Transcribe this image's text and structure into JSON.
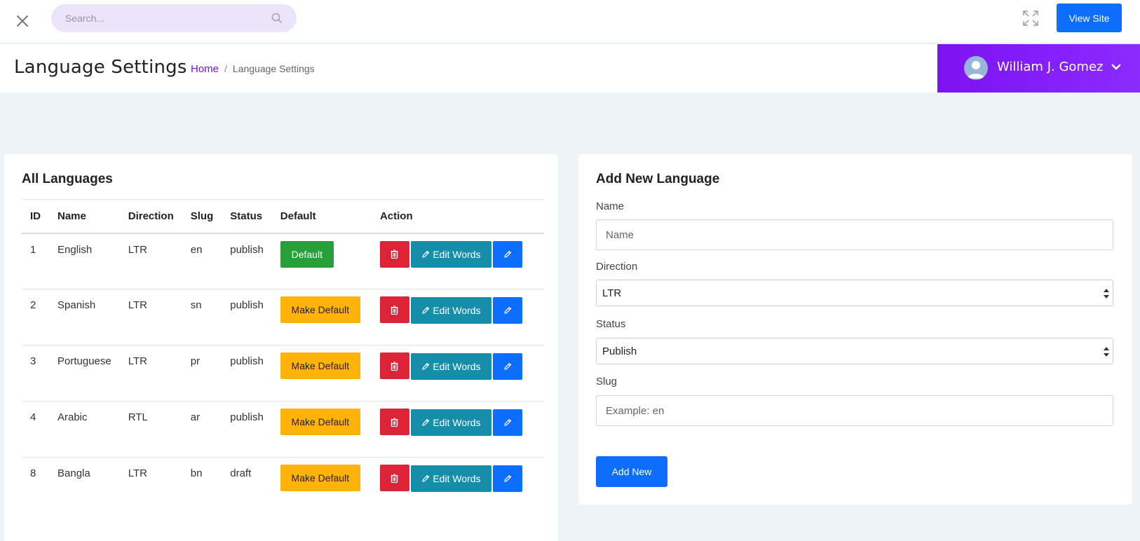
{
  "topbar": {
    "search_placeholder": "Search...",
    "view_site_label": "View Site"
  },
  "header": {
    "page_title": "Language Settings",
    "breadcrumb": {
      "home": "Home",
      "separator": "/",
      "current": "Language Settings"
    },
    "user_name": "William J. Gomez"
  },
  "languages_card": {
    "title": "All Languages",
    "columns": [
      "ID",
      "Name",
      "Direction",
      "Slug",
      "Status",
      "Default",
      "Action"
    ],
    "rows": [
      {
        "id": "1",
        "name": "English",
        "direction": "LTR",
        "slug": "en",
        "status": "publish",
        "default_label": "Default",
        "is_default": true,
        "edit_label": "Edit Words"
      },
      {
        "id": "2",
        "name": "Spanish",
        "direction": "LTR",
        "slug": "sn",
        "status": "publish",
        "default_label": "Make Default",
        "is_default": false,
        "edit_label": "Edit Words"
      },
      {
        "id": "3",
        "name": "Portuguese",
        "direction": "LTR",
        "slug": "pr",
        "status": "publish",
        "default_label": "Make Default",
        "is_default": false,
        "edit_label": "Edit Words"
      },
      {
        "id": "4",
        "name": "Arabic",
        "direction": "RTL",
        "slug": "ar",
        "status": "publish",
        "default_label": "Make Default",
        "is_default": false,
        "edit_label": "Edit Words"
      },
      {
        "id": "8",
        "name": "Bangla",
        "direction": "LTR",
        "slug": "bn",
        "status": "draft",
        "default_label": "Make Default",
        "is_default": false,
        "edit_label": "Edit Words"
      }
    ]
  },
  "add_form": {
    "title": "Add New Language",
    "name_label": "Name",
    "name_placeholder": "Name",
    "direction_label": "Direction",
    "direction_value": "LTR",
    "status_label": "Status",
    "status_value": "Publish",
    "slug_label": "Slug",
    "slug_placeholder": "Example: en",
    "submit_label": "Add New"
  },
  "colors": {
    "accent_purple": "#7c12f0",
    "primary_blue": "#0d6efd",
    "success_green": "#28a039",
    "warning_yellow": "#ffb20a",
    "danger_red": "#dc2338",
    "info_teal": "#178ea9"
  }
}
